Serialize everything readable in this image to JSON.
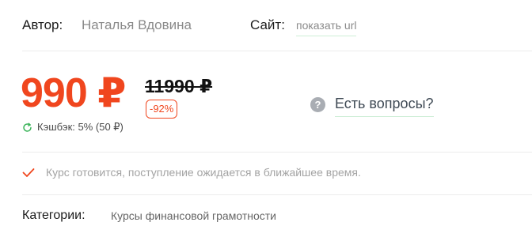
{
  "author": {
    "label": "Автор:",
    "name": "Наталья Вдовина"
  },
  "site": {
    "label": "Сайт:",
    "link_text": "показать url"
  },
  "pricing": {
    "price": "990 ₽",
    "old_price": "11990 ₽",
    "discount": "-92%",
    "cashback": "Кэшбэк: 5% (50 ₽)"
  },
  "questions": {
    "label": "Есть вопросы?",
    "icon_glyph": "?"
  },
  "status": {
    "text": "Курс готовится, поступление ожидается в ближайшее время."
  },
  "categories": {
    "label": "Категории:",
    "value": "Курсы финансовой грамотности"
  },
  "colors": {
    "accent": "#f0461e",
    "cashback_icon": "#3cb45a",
    "link_underline": "#cdeed6"
  },
  "icons": {
    "cashback": "refresh-icon",
    "question": "question-circle-icon",
    "status": "check-icon"
  }
}
